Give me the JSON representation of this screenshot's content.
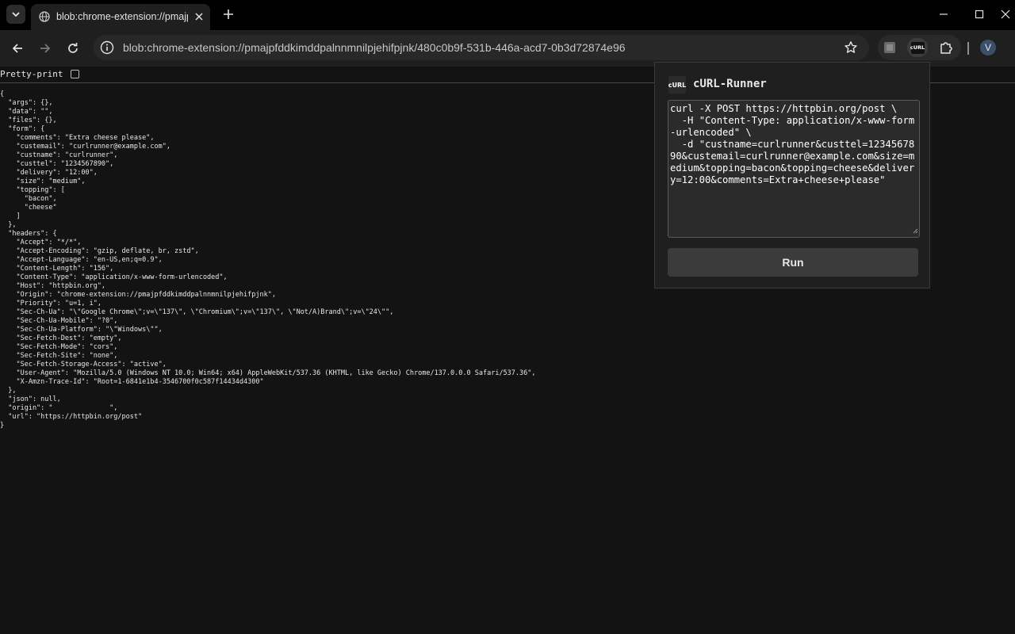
{
  "browser": {
    "tab_title": "blob:chrome-extension://pmajp",
    "url": "blob:chrome-extension://pmajpfddkimddpalnnmnilpjehifpjnk/480c0b9f-531b-446a-acd7-0b3d72874e96",
    "avatar_initial": "V",
    "curl_ext_icon_label": "cURL"
  },
  "page": {
    "pretty_print_label": "Pretty-print",
    "pretty_print_checked": false,
    "json_text": "{\n  \"args\": {},\n  \"data\": \"\",\n  \"files\": {},\n  \"form\": {\n    \"comments\": \"Extra cheese please\",\n    \"custemail\": \"curlrunner@example.com\",\n    \"custname\": \"curlrunner\",\n    \"custtel\": \"1234567890\",\n    \"delivery\": \"12:00\",\n    \"size\": \"medium\",\n    \"topping\": [\n      \"bacon\",\n      \"cheese\"\n    ]\n  },\n  \"headers\": {\n    \"Accept\": \"*/*\",\n    \"Accept-Encoding\": \"gzip, deflate, br, zstd\",\n    \"Accept-Language\": \"en-US,en;q=0.9\",\n    \"Content-Length\": \"156\",\n    \"Content-Type\": \"application/x-www-form-urlencoded\",\n    \"Host\": \"httpbin.org\",\n    \"Origin\": \"chrome-extension://pmajpfddkimddpalnnmnilpjehifpjnk\",\n    \"Priority\": \"u=1, i\",\n    \"Sec-Ch-Ua\": \"\\\"Google Chrome\\\";v=\\\"137\\\", \\\"Chromium\\\";v=\\\"137\\\", \\\"Not/A)Brand\\\";v=\\\"24\\\"\",\n    \"Sec-Ch-Ua-Mobile\": \"?0\",\n    \"Sec-Ch-Ua-Platform\": \"\\\"Windows\\\"\",\n    \"Sec-Fetch-Dest\": \"empty\",\n    \"Sec-Fetch-Mode\": \"cors\",\n    \"Sec-Fetch-Site\": \"none\",\n    \"Sec-Fetch-Storage-Access\": \"active\",\n    \"User-Agent\": \"Mozilla/5.0 (Windows NT 10.0; Win64; x64) AppleWebKit/537.36 (KHTML, like Gecko) Chrome/137.0.0.0 Safari/537.36\",\n    \"X-Amzn-Trace-Id\": \"Root=1-6841e1b4-3546700f0c587f14434d4300\"\n  },\n  \"json\": null,\n  \"origin\": \"              \",\n  \"url\": \"https://httpbin.org/post\"\n}"
  },
  "popup": {
    "logo_text": "cURL",
    "title": "cURL-Runner",
    "command": "curl -X POST https://httpbin.org/post \\\n  -H \"Content-Type: application/x-www-form-urlencoded\" \\\n  -d \"custname=curlrunner&custtel=1234567890&custemail=curlrunner@example.com&size=medium&topping=bacon&topping=cheese&delivery=12:00&comments=Extra+cheese+please\"",
    "run_label": "Run"
  }
}
